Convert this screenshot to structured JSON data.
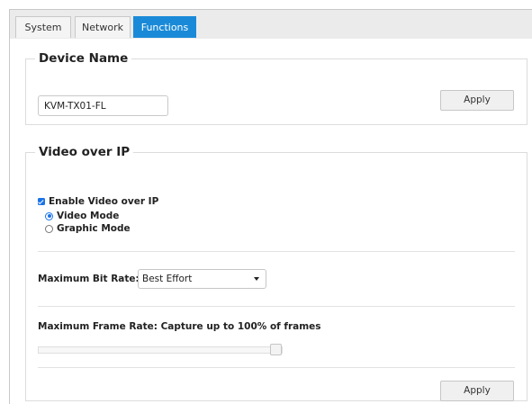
{
  "tabs": [
    {
      "label": "System",
      "active": false
    },
    {
      "label": "Network",
      "active": false
    },
    {
      "label": "Functions",
      "active": true
    }
  ],
  "device_name": {
    "legend": "Device Name",
    "value": "KVM-TX01-FL",
    "apply_label": "Apply"
  },
  "video_over_ip": {
    "legend": "Video over IP",
    "enable_label": "Enable Video over IP",
    "enable_checked": true,
    "modes": [
      {
        "label": "Video Mode",
        "selected": true
      },
      {
        "label": "Graphic Mode",
        "selected": false
      }
    ],
    "bitrate_label": "Maximum Bit Rate:",
    "bitrate_value": "Best Effort",
    "framerate_label": "Maximum Frame Rate: Capture up to 100% of frames",
    "framerate_percent": 100,
    "apply_label": "Apply"
  },
  "colors": {
    "active_tab": "#1a8ad8",
    "accent": "#1a73e8"
  }
}
